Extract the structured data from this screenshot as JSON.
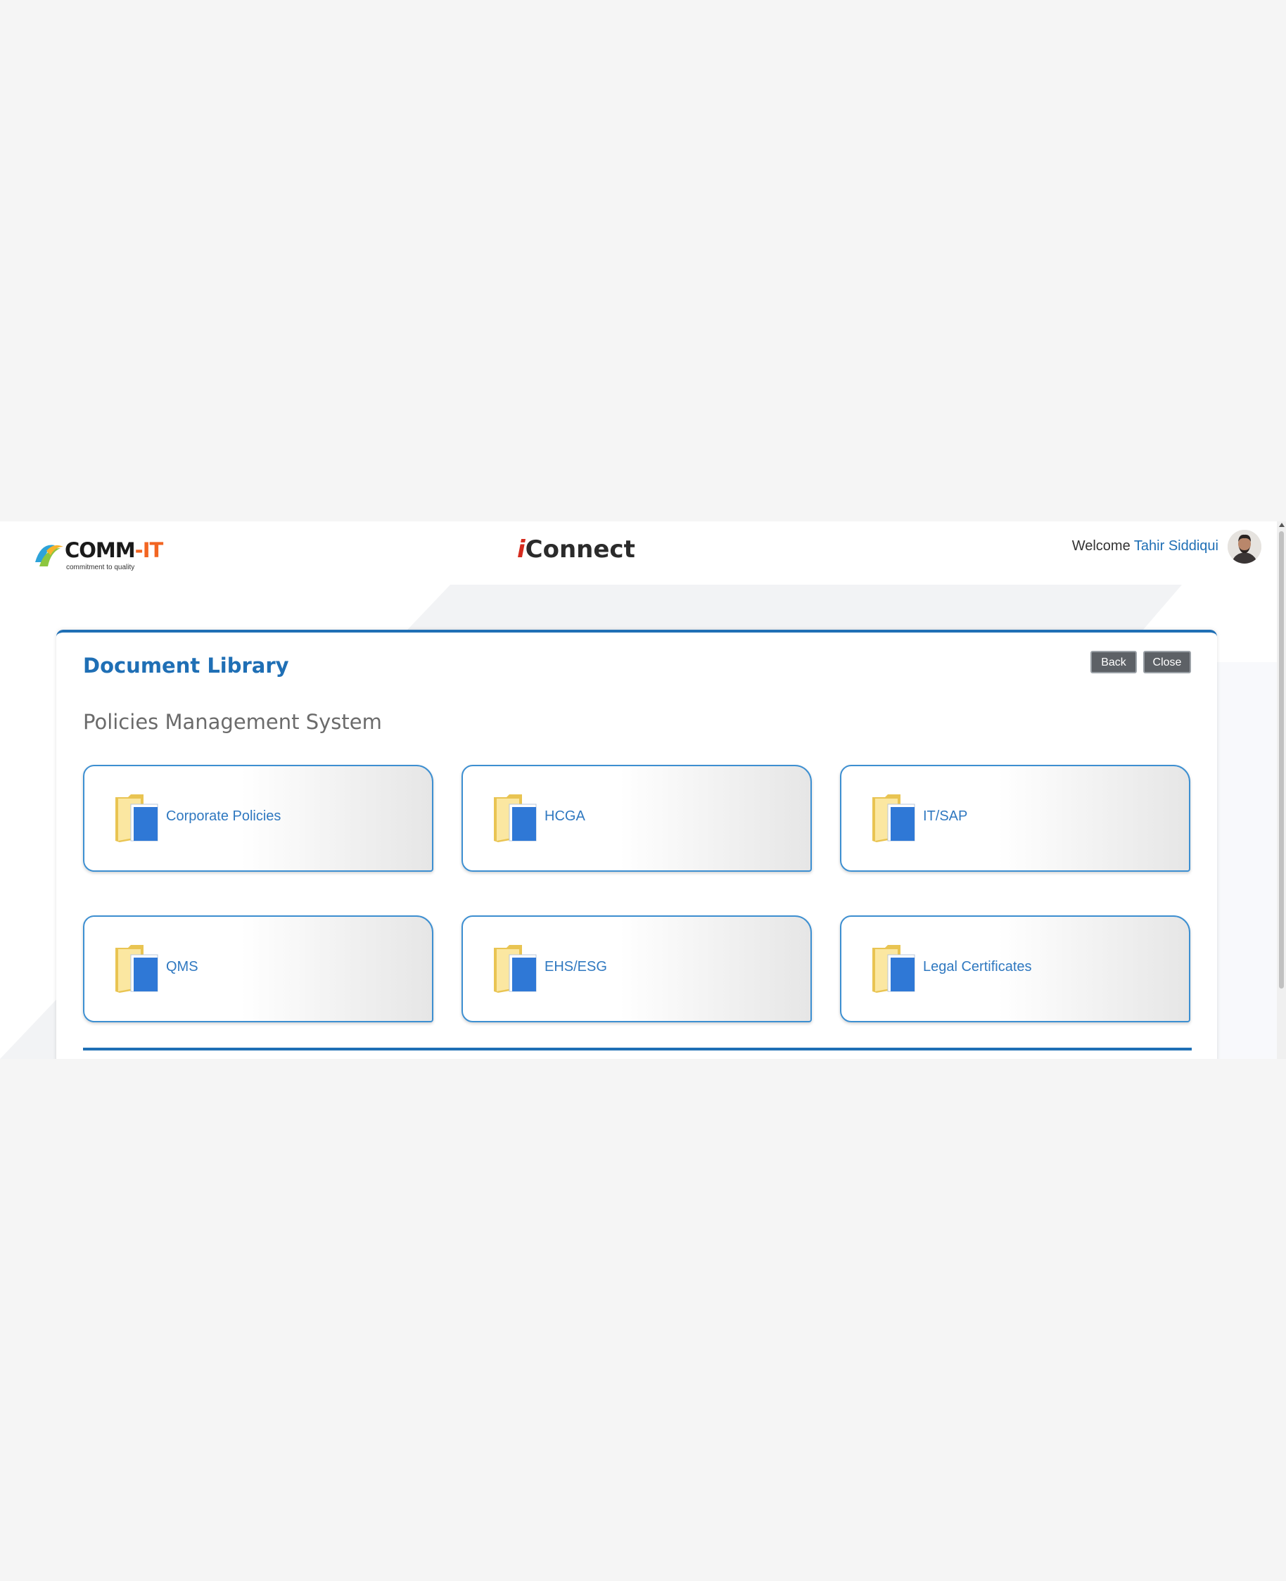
{
  "header": {
    "logo_text": "COMM",
    "logo_text_suffix": "-IT",
    "logo_tagline": "commitment to quality",
    "brand_prefix": "i",
    "brand_name": "Connect",
    "welcome_label": "Welcome",
    "user_name": "Tahir Siddiqui"
  },
  "panel": {
    "title": "Document Library",
    "subtitle": "Policies Management System",
    "back_label": "Back",
    "close_label": "Close"
  },
  "tiles": [
    {
      "label": "Corporate Policies",
      "icon": "folder-icon"
    },
    {
      "label": "HCGA",
      "icon": "folder-icon"
    },
    {
      "label": "IT/SAP",
      "icon": "folder-icon"
    },
    {
      "label": "QMS",
      "icon": "folder-icon"
    },
    {
      "label": "EHS/ESG",
      "icon": "folder-icon"
    },
    {
      "label": "Legal Certificates",
      "icon": "folder-icon"
    }
  ],
  "colors": {
    "accent": "#1f6fb5",
    "tile_border": "#3d8fd1",
    "button_bg": "#5d6166",
    "folder_yellow": "#f5d76e",
    "book_blue": "#2f78d6"
  }
}
